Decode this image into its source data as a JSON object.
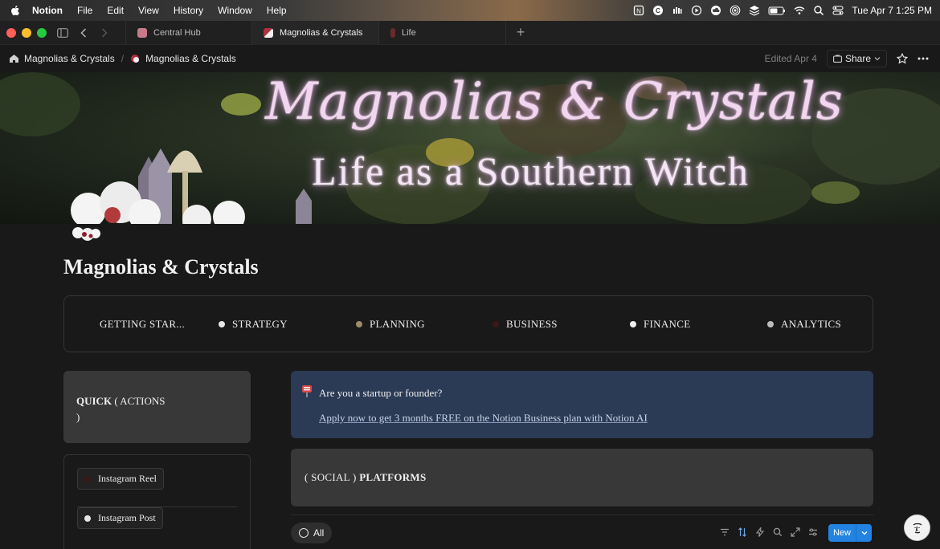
{
  "menubar": {
    "app": "Notion",
    "items": [
      "File",
      "Edit",
      "View",
      "History",
      "Window",
      "Help"
    ],
    "datetime": "Tue Apr 7  1:25 PM"
  },
  "tabs": [
    {
      "label": "Central Hub",
      "active": false
    },
    {
      "label": "Magnolias & Crystals",
      "active": true
    },
    {
      "label": "Life",
      "active": false
    }
  ],
  "breadcrumb": {
    "root": "Magnolias & Crystals",
    "current": "Magnolias & Crystals"
  },
  "topbar": {
    "edited": "Edited Apr 4",
    "share": "Share"
  },
  "cover": {
    "title": "Magnolias & Crystals",
    "subtitle": "Life as a Southern Witch"
  },
  "page": {
    "title": "Magnolias & Crystals"
  },
  "nav": {
    "items": [
      {
        "label": "GETTING STAR...",
        "dot": "#191919"
      },
      {
        "label": "STRATEGY",
        "dot": "#e6e6e6"
      },
      {
        "label": "PLANNING",
        "dot": "#a08a6a"
      },
      {
        "label": "BUSINESS",
        "dot": "#3a1818"
      },
      {
        "label": "FINANCE",
        "dot": "#f0f0f0"
      },
      {
        "label": "ANALYTICS",
        "dot": "#bdbdbd"
      }
    ]
  },
  "quick": {
    "prefix": "QUICK",
    "paren_open": "( ACTIONS",
    "paren_close": ")"
  },
  "quick_list": {
    "items": [
      {
        "label": "Instagram Reel",
        "dot": "#3a1818"
      },
      {
        "label": "Instagram Post",
        "dot": "#e6e6e6"
      }
    ]
  },
  "callout": {
    "question": "Are you a startup or founder?",
    "link": "Apply now to get 3 months FREE on the Notion Business plan with Notion AI"
  },
  "social": {
    "prefix": "( SOCIAL )",
    "bold": "PLATFORMS"
  },
  "db": {
    "view": "All",
    "new_label": "New"
  }
}
